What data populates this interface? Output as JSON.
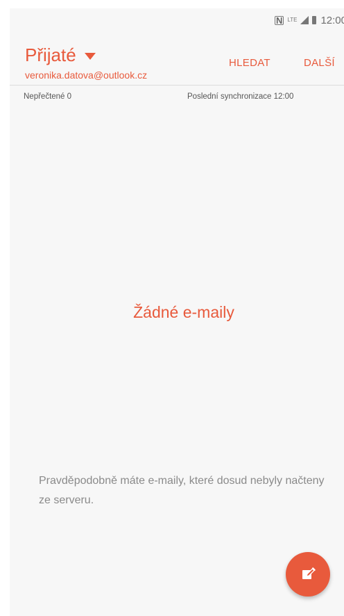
{
  "status_bar": {
    "nfc_label": "N",
    "network_label": "LTE",
    "time": "12:00"
  },
  "header": {
    "folder_title": "Přijaté",
    "account_email": "veronika.datova@outlook.cz",
    "search_label": "HLEDAT",
    "more_label": "DALŠÍ"
  },
  "info_bar": {
    "unread": "Nepřečtené 0",
    "last_sync": "Poslední synchronizace 12:00"
  },
  "empty_state": {
    "title": "Žádné e-maily",
    "hint": "Pravděpodobně máte e-maily, které dosud nebyly načteny ze serveru."
  },
  "colors": {
    "accent": "#e85a3c",
    "background": "#f7f7f7",
    "muted_text": "#8a8a8a"
  },
  "icons": {
    "compose": "compose-icon",
    "dropdown": "dropdown-arrow-icon"
  }
}
